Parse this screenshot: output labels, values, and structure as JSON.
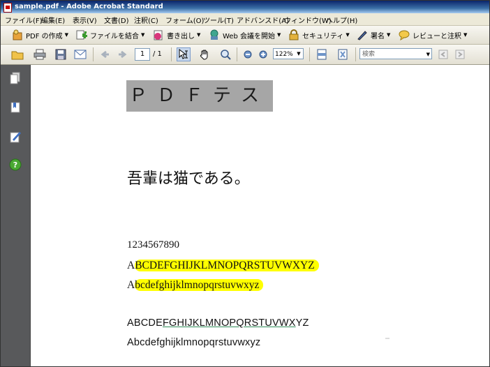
{
  "window": {
    "title": "sample.pdf - Adobe Acrobat Standard"
  },
  "menu": [
    {
      "label": "ファイル(F)"
    },
    {
      "label": "編集(E)"
    },
    {
      "label": "表示(V)"
    },
    {
      "label": "文書(D)"
    },
    {
      "label": "注釈(C)"
    },
    {
      "label": "フォーム(O)"
    },
    {
      "label": "ツール(T)"
    },
    {
      "label": "アドバンスド(A)"
    },
    {
      "label": "ウィンドウ(W)"
    },
    {
      "label": "ヘルプ(H)"
    }
  ],
  "toolbar1": {
    "create_pdf": "PDF の作成",
    "combine": "ファイルを結合",
    "export": "書き出し",
    "web_meeting": "Web 会議を開始",
    "security": "セキュリティ",
    "sign": "署名",
    "review": "レビューと注釈"
  },
  "toolbar2": {
    "page_current": "1",
    "page_total": "/ 1",
    "zoom": "122%",
    "search_placeholder": "検索"
  },
  "document": {
    "title_text": "ＰＤＦテスト",
    "japanese_line": "吾輩は猫である。",
    "digits": "1234567890",
    "caps_first": "A",
    "caps_rest": "BCDEFGHIJKLMNOPQRSTUVWXYZ",
    "lower_first": "A",
    "lower_rest": "bcdefghijklmnopqrstuvwxyz",
    "sans_caps_a": "ABCDE",
    "sans_caps_b": "FGHIJKLMNOPQRSTUVWX",
    "sans_caps_c": "YZ",
    "sans_lower": "Abcdefghijklmnopqrstuvwxyz"
  },
  "colors": {
    "highlight": "#ffff00",
    "nav_panel": "#58595b",
    "title_block": "#a6a6a6"
  }
}
